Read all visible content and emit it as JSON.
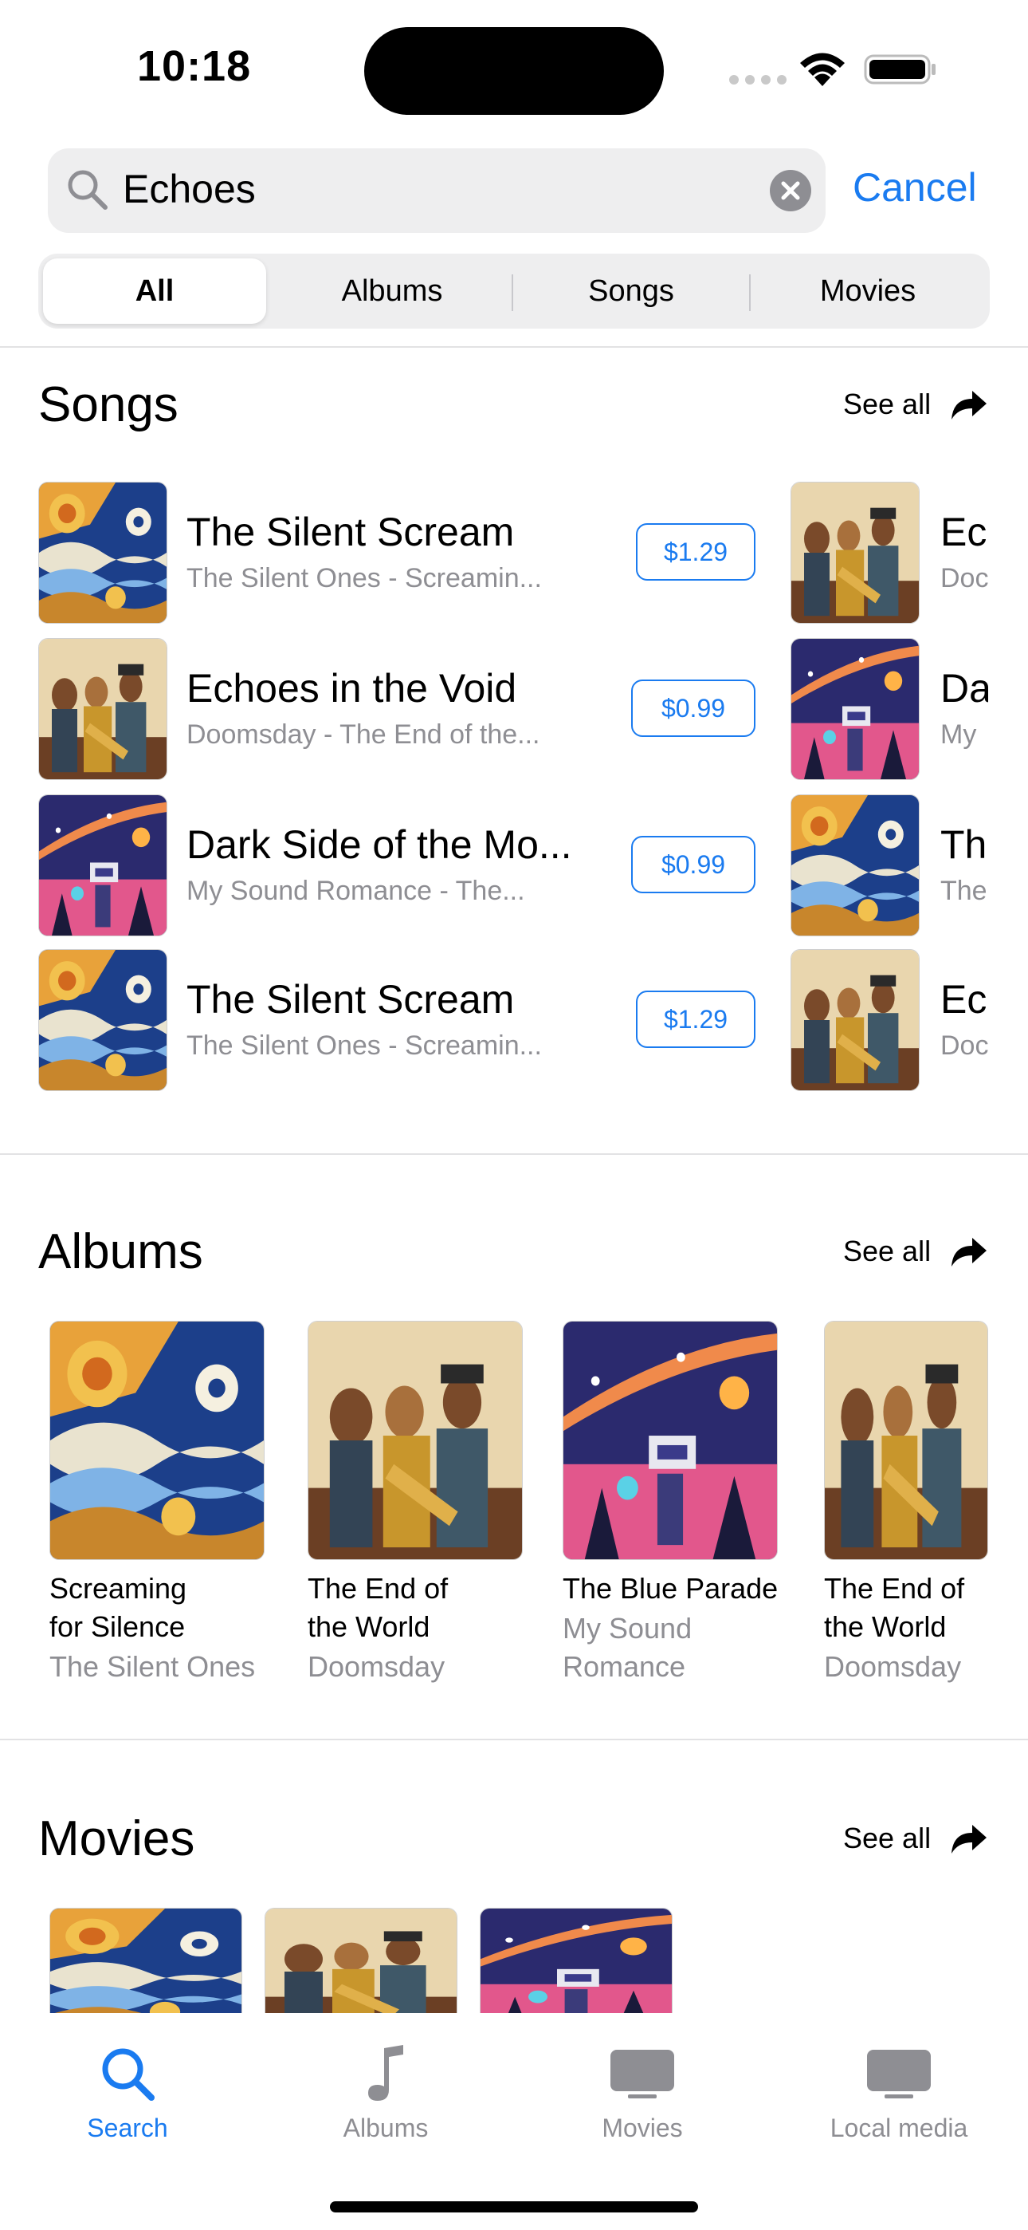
{
  "status_bar": {
    "time": "10:18"
  },
  "search": {
    "query": "Echoes",
    "cancel_label": "Cancel"
  },
  "segments": [
    "All",
    "Albums",
    "Songs",
    "Movies"
  ],
  "songs_section": {
    "title": "Songs",
    "see_all": "See all",
    "rows": [
      {
        "title": "The Silent Scream",
        "subtitle": "The Silent Ones - Screamin...",
        "price": "$1.29",
        "art": "swirl"
      },
      {
        "title": "Echoes in the Void",
        "subtitle": "Doomsday - The End of the...",
        "price": "$0.99",
        "art": "jazz"
      },
      {
        "title": "Dark Side of the Mo...",
        "subtitle": "My Sound Romance - The...",
        "price": "$0.99",
        "art": "space"
      },
      {
        "title": "The Silent Scream",
        "subtitle": "The Silent Ones - Screamin...",
        "price": "$1.29",
        "art": "swirl"
      }
    ],
    "peek_rows": [
      {
        "title": "Ecl",
        "subtitle": "Doc",
        "art": "jazz"
      },
      {
        "title": "Da",
        "subtitle": "My",
        "art": "space"
      },
      {
        "title": "Th",
        "subtitle": "The",
        "art": "swirl"
      },
      {
        "title": "Ecl",
        "subtitle": "Doc",
        "art": "jazz"
      }
    ]
  },
  "albums_section": {
    "title": "Albums",
    "see_all": "See all",
    "items": [
      {
        "title_line1": "Screaming",
        "title_line2": "for Silence",
        "artist_line1": "The Silent Ones",
        "artist_line2": "",
        "art": "swirl"
      },
      {
        "title_line1": "The End of",
        "title_line2": "the World",
        "artist_line1": "Doomsday",
        "artist_line2": "",
        "art": "jazz"
      },
      {
        "title_line1": "The Blue Parade",
        "title_line2": "",
        "artist_line1": "My Sound",
        "artist_line2": "Romance",
        "art": "space"
      },
      {
        "title_line1": "The End of",
        "title_line2": "the World",
        "artist_line1": "Doomsday",
        "artist_line2": "",
        "art": "jazz"
      }
    ]
  },
  "movies_section": {
    "title": "Movies",
    "see_all": "See all",
    "items": [
      {
        "art": "swirl"
      },
      {
        "art": "jazz"
      },
      {
        "art": "space"
      }
    ]
  },
  "tab_bar": {
    "tabs": [
      {
        "label": "Search",
        "icon": "search-icon",
        "active": true
      },
      {
        "label": "Albums",
        "icon": "music-note-icon",
        "active": false
      },
      {
        "label": "Movies",
        "icon": "tv-icon",
        "active": false
      },
      {
        "label": "Local media",
        "icon": "tv-icon",
        "active": false
      }
    ]
  },
  "colors": {
    "accent": "#1a7bf0",
    "secondary_text": "#8e8e93",
    "field_bg": "#eeeeef"
  }
}
